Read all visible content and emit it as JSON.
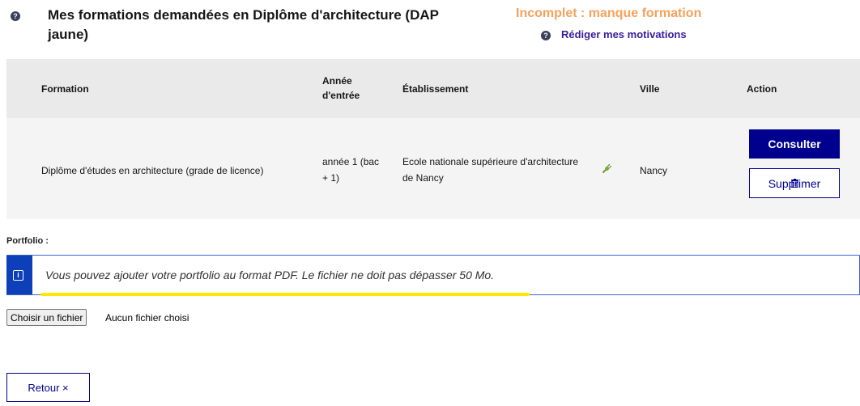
{
  "header": {
    "title": "Mes formations demandées en Diplôme d'architecture (DAP jaune)",
    "status": "Incomplet : manque formation",
    "motivation_link": "Rédiger mes motivations",
    "help_icon": "?"
  },
  "table": {
    "headers": {
      "formation": "Formation",
      "annee": "Année d'entrée",
      "etablissement": "Établissement",
      "ville": "Ville",
      "action": "Action"
    },
    "row": {
      "formation": "Diplôme d'études en architecture (grade de licence)",
      "annee": "année 1 (bac + 1)",
      "etablissement": "Ecole nationale supérieure d'architecture de Nancy",
      "ville": "Nancy",
      "consulter": "Consulter",
      "supprimer": "Supprimer"
    }
  },
  "portfolio": {
    "label": "Portfolio :",
    "info_icon": "i",
    "info": "Vous pouvez ajouter votre portfolio au format PDF. Le fichier ne doit pas dépasser 50 Mo.",
    "file_button": "Choisir un fichier",
    "file_status": "Aucun fichier choisi"
  },
  "footer": {
    "retour": "Retour ×"
  },
  "colors": {
    "primary": "#00008f",
    "status": "#f5a25d",
    "link": "#3a1d9b",
    "info": "#0c3fb8",
    "highlight": "#ffe800"
  }
}
